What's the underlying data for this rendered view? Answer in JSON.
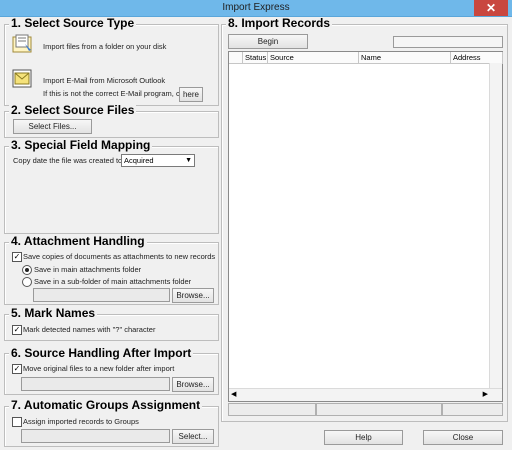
{
  "window": {
    "title": "Import Express"
  },
  "sections": {
    "source_type": {
      "title": "1. Select Source Type",
      "import_files_label": "Import files from a folder on your disk",
      "import_outlook_label": "Import E-Mail from Microsoft Outlook",
      "not_correct_label": "If this is not the correct E-Mail program, click",
      "here_button": "here"
    },
    "source_files": {
      "title": "2. Select Source Files",
      "select_files_button": "Select Files..."
    },
    "field_mapping": {
      "title": "3. Special Field Mapping",
      "copy_date_label": "Copy date the file was created to:",
      "copy_date_value": "Acquired"
    },
    "attachment": {
      "title": "4. Attachment Handling",
      "save_copies_label": "Save copies of documents as attachments to new records",
      "save_copies_checked": true,
      "radio_main_label": "Save in main attachments folder",
      "radio_sub_label": "Save in a sub-folder of main attachments folder",
      "browse_button": "Browse..."
    },
    "mark_names": {
      "title": "5. Mark Names",
      "mark_label": "Mark detected names with \"?\" character",
      "mark_checked": true
    },
    "source_handling": {
      "title": "6. Source Handling After Import",
      "move_label": "Move original files to a new folder after import",
      "move_checked": true,
      "browse_button": "Browse..."
    },
    "groups": {
      "title": "7. Automatic Groups Assignment",
      "assign_label": "Assign imported records to Groups",
      "assign_checked": false,
      "select_button": "Select..."
    },
    "import_records": {
      "title": "8. Import Records",
      "begin_button": "Begin",
      "columns": [
        "Status",
        "Source",
        "Name",
        "Address"
      ]
    }
  },
  "footer": {
    "help_button": "Help",
    "close_button": "Close"
  },
  "icons": {
    "close": "close-icon",
    "folder": "folder-import-icon",
    "outlook": "outlook-icon"
  }
}
